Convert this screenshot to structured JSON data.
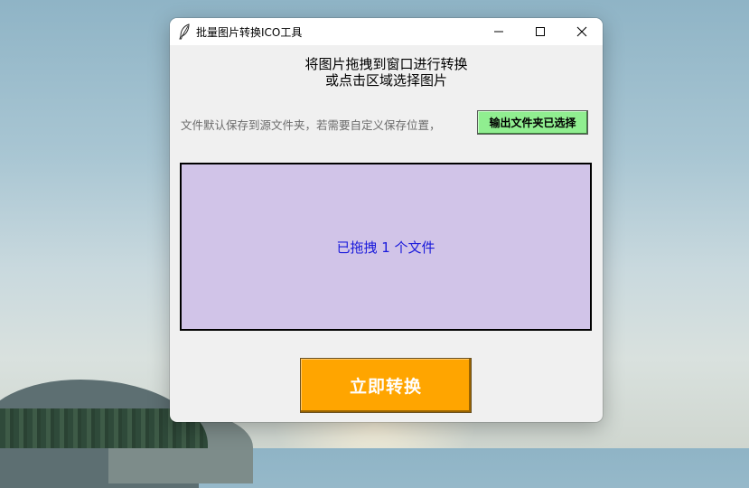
{
  "window": {
    "title": "批量图片转换ICO工具",
    "app_icon": "feather-icon",
    "controls": [
      "minimize-icon",
      "maximize-icon",
      "close-icon"
    ]
  },
  "main": {
    "instruction_line1": "将图片拖拽到窗口进行转换",
    "instruction_line2": "或点击区域选择图片",
    "save_note": "文件默认保存到源文件夹，若需要自定义保存位置，",
    "output_button_label": "输出文件夹已选择",
    "drop_status": "已拖拽 1 个文件",
    "convert_button_label": "立即转换"
  },
  "colors": {
    "output_button_bg": "#90ee90",
    "dropzone_bg": "#d1c4e8",
    "drop_status_text": "#1a1adb",
    "convert_button_bg": "#ffa500"
  }
}
